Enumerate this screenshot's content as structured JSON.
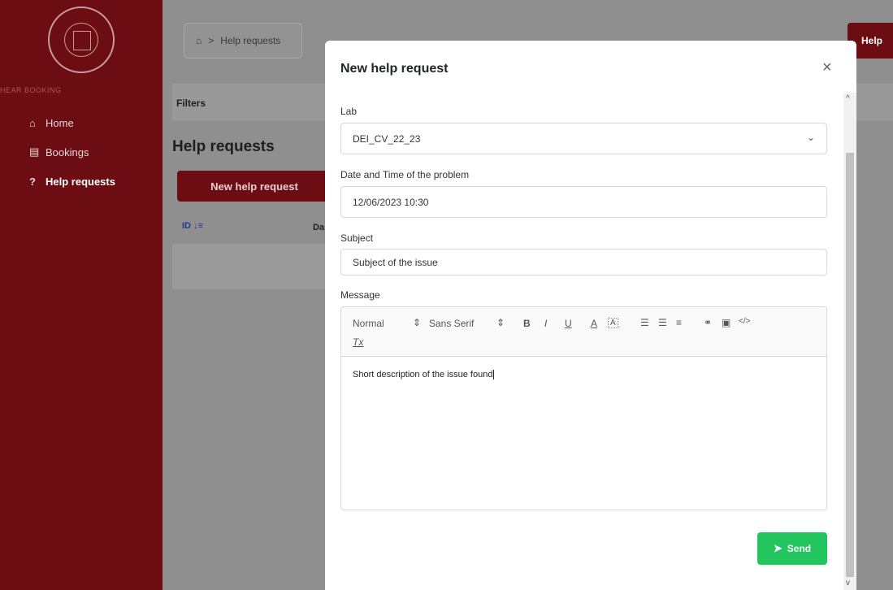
{
  "sidebar": {
    "brand": "HEAR BOOKING",
    "items": [
      {
        "icon": "home-icon",
        "glyph": "⌂",
        "label": "Home"
      },
      {
        "icon": "calendar-icon",
        "glyph": "▤",
        "label": "Bookings"
      },
      {
        "icon": "question-icon",
        "glyph": "?",
        "label": "Help requests"
      }
    ]
  },
  "breadcrumb": {
    "icon": "home-icon",
    "separator": ">",
    "current": "Help requests"
  },
  "header_button": "Help",
  "filters_label": "Filters",
  "page_title": "Help requests",
  "new_button": "New help request",
  "table": {
    "columns": [
      "ID",
      "Da"
    ]
  },
  "modal": {
    "title": "New help request",
    "close": "×",
    "lab_label": "Lab",
    "lab_value": "DEI_CV_22_23",
    "datetime_label": "Date and Time of the problem",
    "datetime_value": "12/06/2023 10:30",
    "subject_label": "Subject",
    "subject_value": "Subject of the issue",
    "message_label": "Message",
    "toolbar": {
      "size": "Normal",
      "font": "Sans Serif",
      "bold": "B",
      "italic": "I",
      "underline": "U",
      "color": "A",
      "background": "A",
      "clear": "Tx"
    },
    "message_text": "Short description of the issue found",
    "send_label": "Send"
  },
  "colors": {
    "brand": "#6b0d12",
    "send": "#22c55e"
  }
}
